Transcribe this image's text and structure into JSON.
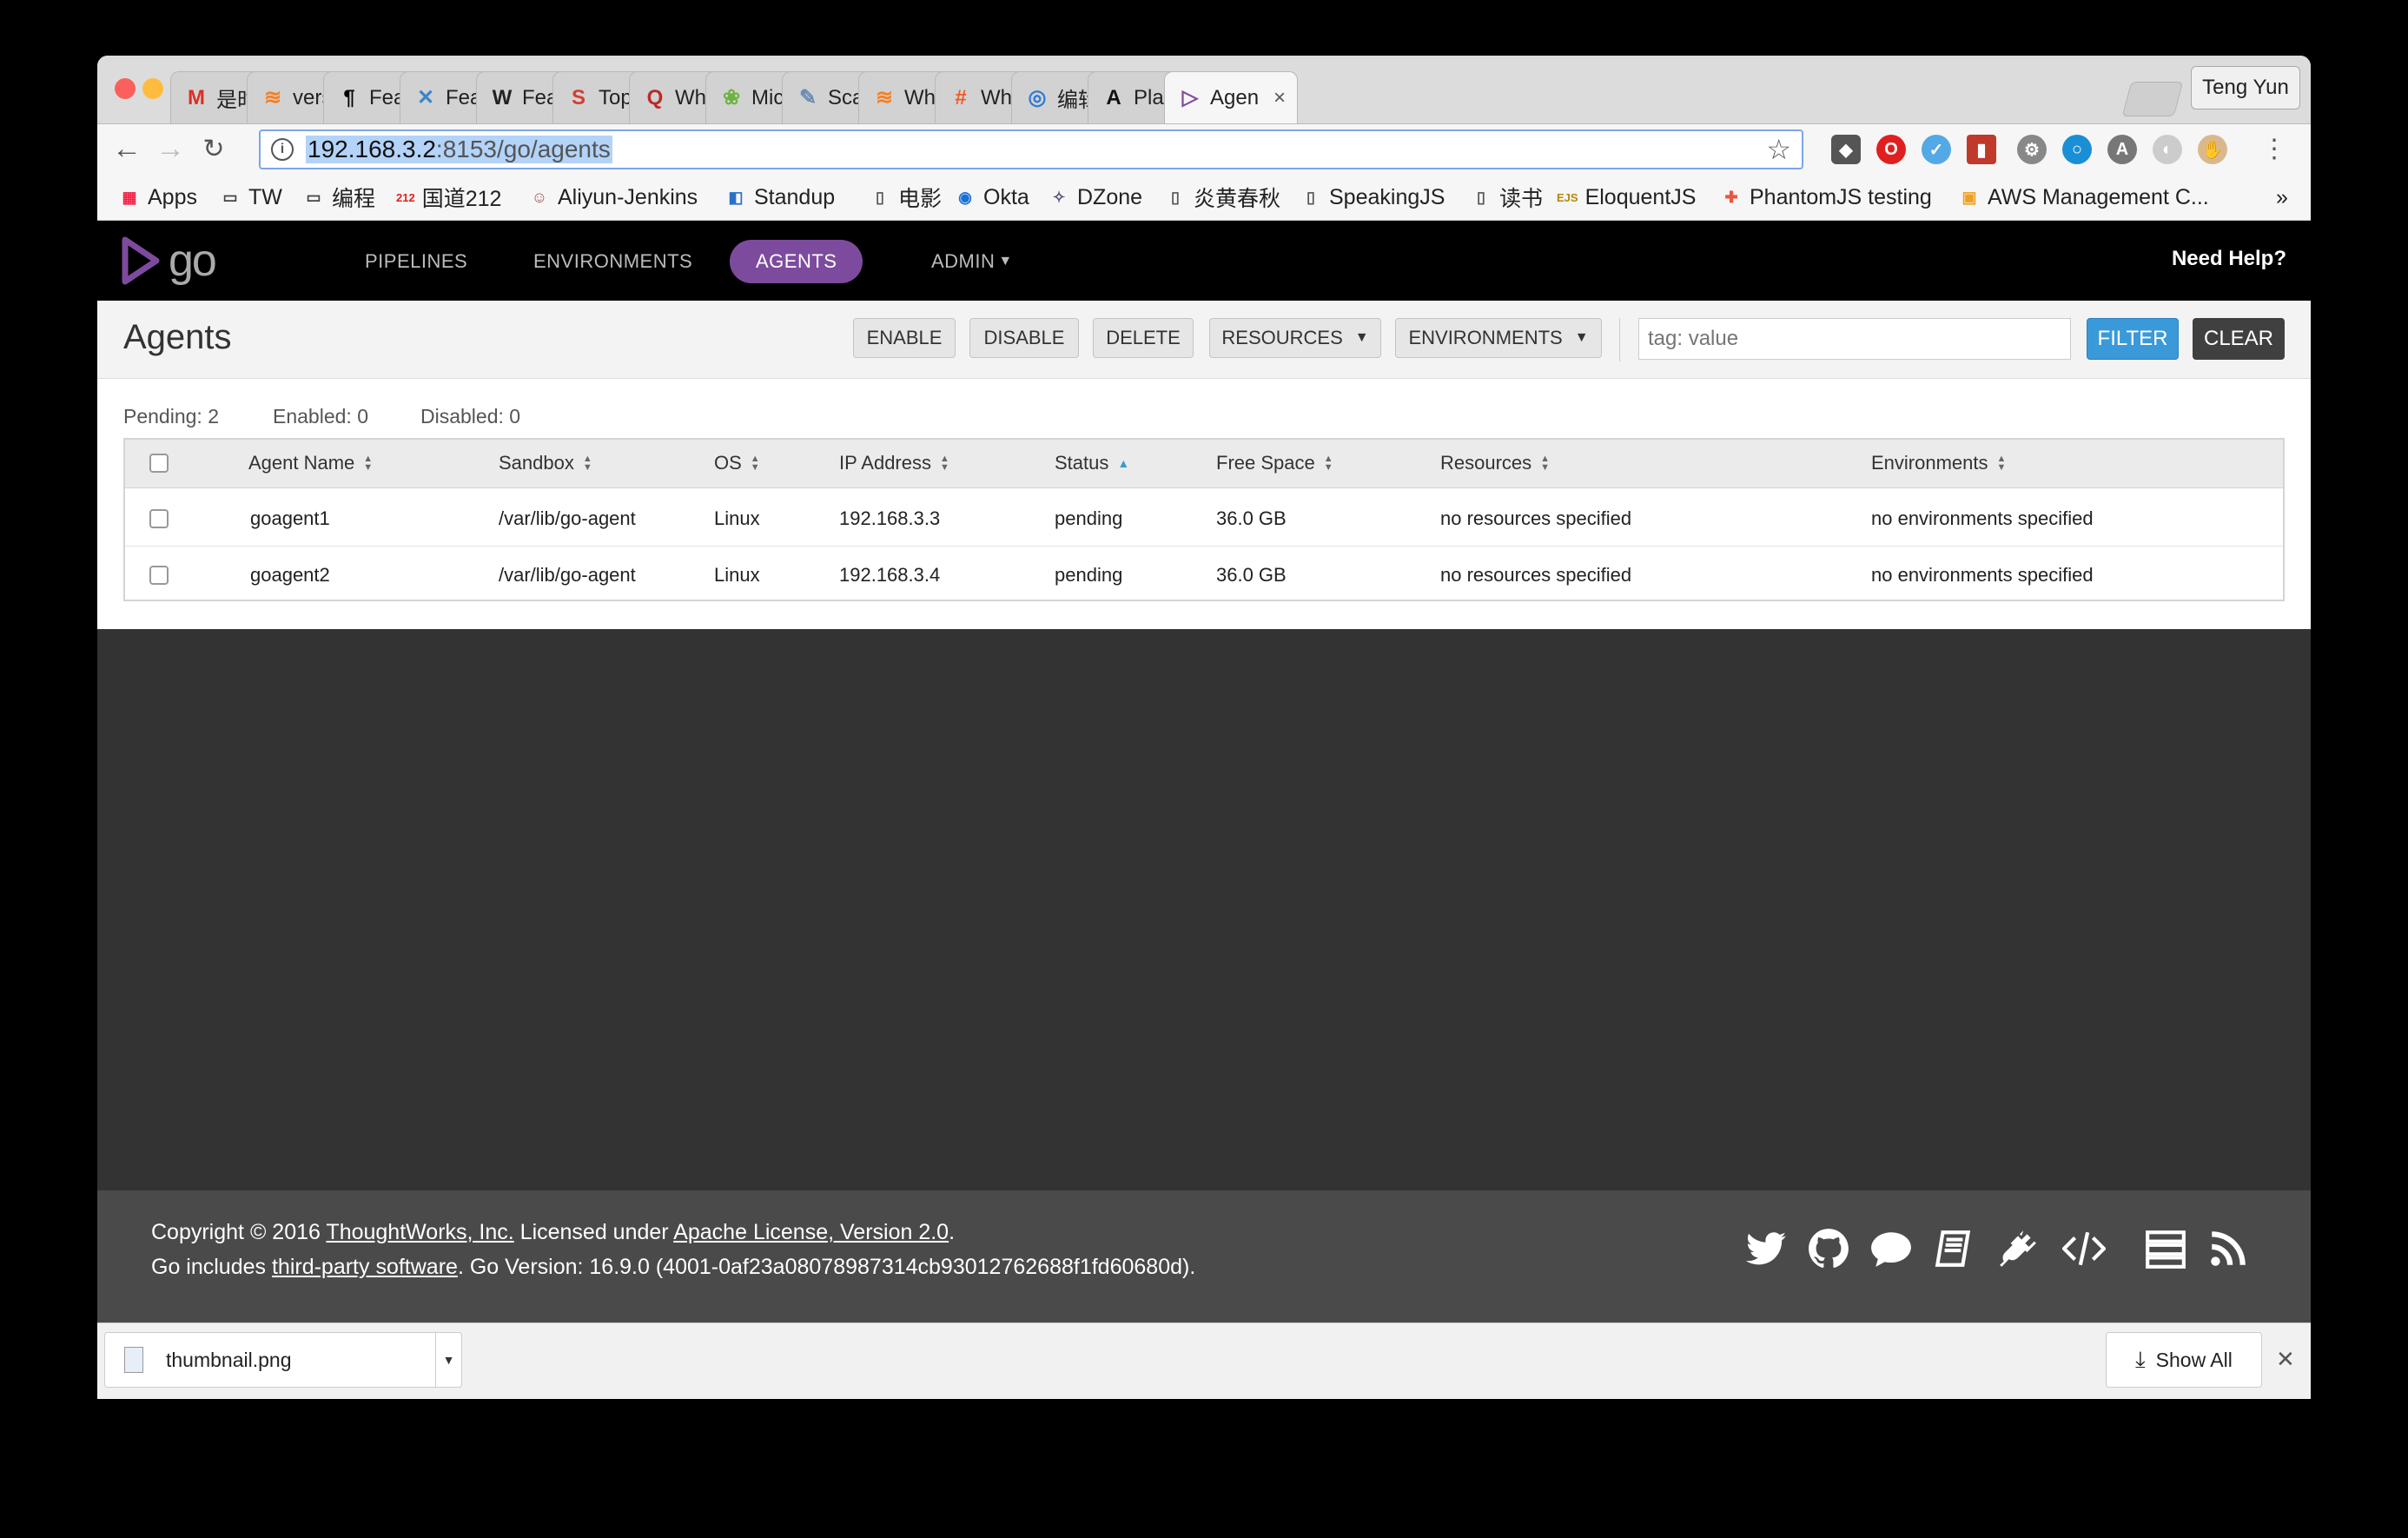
{
  "browser": {
    "profile_name": "Teng Yun",
    "tabs": [
      {
        "title": "是时",
        "icon": "M",
        "icon_color": "#d93025"
      },
      {
        "title": "vers",
        "icon": "≋",
        "icon_color": "#f48024"
      },
      {
        "title": "Feat",
        "icon": "¶",
        "icon_color": "#000000"
      },
      {
        "title": "Feat",
        "icon": "✕",
        "icon_color": "#3a86c8"
      },
      {
        "title": "Feat",
        "icon": "W",
        "icon_color": "#222222"
      },
      {
        "title": "Top",
        "icon": "S",
        "icon_color": "#d33f2f"
      },
      {
        "title": "Wha",
        "icon": "Q",
        "icon_color": "#b92b27"
      },
      {
        "title": "Micr",
        "icon": "❀",
        "icon_color": "#6db33f"
      },
      {
        "title": "Scal",
        "icon": "✎",
        "icon_color": "#6a8bb3"
      },
      {
        "title": "Wha",
        "icon": "≋",
        "icon_color": "#f48024"
      },
      {
        "title": "Whi",
        "icon": "#",
        "icon_color": "#f05a28"
      },
      {
        "title": "编辑",
        "icon": "◎",
        "icon_color": "#2f7ad6"
      },
      {
        "title": "Play",
        "icon": "A",
        "icon_color": "#111111"
      },
      {
        "title": "Agen",
        "icon": "▷",
        "icon_color": "#7d4b9e"
      }
    ],
    "url_host": "192.168.3.2",
    "url_rest": ":8153/go/agents",
    "bookmarks": [
      {
        "label": "Apps",
        "icon": "apps-grid-icon"
      },
      {
        "label": "TW",
        "icon": "folder-icon"
      },
      {
        "label": "编程",
        "icon": "folder-icon"
      },
      {
        "label": "国道212",
        "icon": "212-icon"
      },
      {
        "label": "Aliyun-Jenkins",
        "icon": "jenkins-icon"
      },
      {
        "label": "Standup",
        "icon": "standup-icon"
      },
      {
        "label": "电影",
        "icon": "page-icon"
      },
      {
        "label": "Okta",
        "icon": "okta-icon"
      },
      {
        "label": "DZone",
        "icon": "dzone-icon"
      },
      {
        "label": "炎黄春秋",
        "icon": "page-icon"
      },
      {
        "label": "SpeakingJS",
        "icon": "page-icon"
      },
      {
        "label": "读书",
        "icon": "page-icon"
      },
      {
        "label": "EloquentJS",
        "icon": "ejs-icon"
      },
      {
        "label": "PhantomJS testing",
        "icon": "plus-icon"
      },
      {
        "label": "AWS Management C...",
        "icon": "aws-icon"
      }
    ],
    "more_bookmarks": "»"
  },
  "gocd": {
    "logo_text": "go",
    "nav": [
      "PIPELINES",
      "ENVIRONMENTS",
      "AGENTS",
      "ADMIN"
    ],
    "help": "Need Help?",
    "page_title": "Agents",
    "buttons": {
      "enable": "ENABLE",
      "disable": "DISABLE",
      "delete": "DELETE",
      "resources": "RESOURCES",
      "environments": "ENVIRONMENTS",
      "filter": "FILTER",
      "clear": "CLEAR"
    },
    "filter_placeholder": "tag: value",
    "counts": {
      "pending": "Pending: 2",
      "enabled": "Enabled: 0",
      "disabled": "Disabled: 0"
    },
    "columns": [
      "Agent Name",
      "Sandbox",
      "OS",
      "IP Address",
      "Status",
      "Free Space",
      "Resources",
      "Environments"
    ],
    "agents": [
      {
        "name": "goagent1",
        "sandbox": "/var/lib/go-agent",
        "os": "Linux",
        "ip": "192.168.3.3",
        "status": "pending",
        "free_space": "36.0 GB",
        "resources": "no resources specified",
        "environments": "no environments specified"
      },
      {
        "name": "goagent2",
        "sandbox": "/var/lib/go-agent",
        "os": "Linux",
        "ip": "192.168.3.4",
        "status": "pending",
        "free_space": "36.0 GB",
        "resources": "no resources specified",
        "environments": "no environments specified"
      }
    ],
    "footer": {
      "line1_a": "Copyright © 2016 ",
      "line1_link1": "ThoughtWorks, Inc.",
      "line1_b": " Licensed under ",
      "line1_link2": "Apache License, Version 2.0",
      "line1_c": ".",
      "line2_a": "Go includes ",
      "line2_link": "third-party software",
      "line2_b": ". Go Version: 16.9.0 (4001-0af23a08078987314cb93012762688f1fd60680d)."
    },
    "accent_color": "#7d4b9e",
    "filter_color": "#3a9ad9"
  },
  "downloads": {
    "file": "thumbnail.png",
    "show_all": "Show All"
  }
}
